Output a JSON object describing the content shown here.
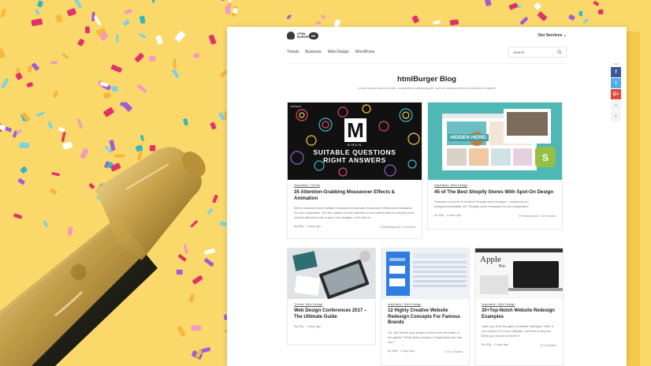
{
  "logo": {
    "text": "HTML BURGER",
    "badge": "BE"
  },
  "header": {
    "services_label": "Our Services",
    "services_icon": "chevron-down-icon"
  },
  "nav": {
    "items": [
      "Trends",
      "Business",
      "Web Design",
      "WordPress"
    ]
  },
  "search": {
    "placeholder": "Search",
    "icon": "search-icon"
  },
  "hero": {
    "title": "htmlBurger Blog",
    "subtitle": "Lorem ipsum dolor sit amet, consectetur adipiscing elit, sed do eiusmod tempor incididunt ut labore"
  },
  "share": {
    "label": "Share",
    "buttons": [
      "f",
      "t",
      "G+"
    ]
  },
  "cards": [
    {
      "image_label_top": "CONTACT",
      "image_brand": "MINNIN",
      "image_headline_1": "SUITABLE QUESTIONS",
      "image_headline_2": "RIGHT ANSWERS",
      "category": "Inspiration, Trends",
      "title": "35 Attention-Grabbing Mouseover Effects & Animation",
      "excerpt": "We've collected some brilliant examples of website mouseover effects and animation for your inspiration. We also added to this collection some useful links for sample (and simple) effects to use in your own designs. Let's dive in.",
      "author": "By Billy",
      "date": "2 days ago",
      "reading": "Reading time: 5 minutes"
    },
    {
      "image_headline": "HIDDEN HERE!",
      "category": "Inspiration, Web Design",
      "title": "45 of The Best Shopify Stores With Spot-On Design",
      "excerpt": "Selection of some of the best Shopify store designs + comments on design/functionality. 40+ Shopify store examples for your inspiration.",
      "author": "By Billy",
      "date": "4 days ago",
      "reading": "Reading time: 10 minutes"
    },
    {
      "category": "Trends, Web Design",
      "title": "Web Design Conferences 2017 – The Ultimate Guide",
      "author": "By Billy",
      "date": "2 days ago"
    },
    {
      "category": "Inspiration, Web Design",
      "title": "12 Highly Creative Website Redesign Concepts For Famous Brands",
      "excerpt": "Ok. But what if your project is less from the scale of the giants? What other sources of inspiration you can use?",
      "author": "By Billy",
      "date": "2 days ago",
      "reading": "11 minutes"
    },
    {
      "image_brand": "Apple",
      "image_product": "Pro",
      "category": "Inspiration, Web Design",
      "title": "30+Top-Notch Website Redesign Examples",
      "excerpt": "Have you ever thought of website redesign? Well, if you haven't it is not a disaster, but here is why we think you should consider it.",
      "author": "By Billy",
      "date": "2 days ago",
      "reading": "9 minutes"
    }
  ],
  "colors": {
    "background": "#fbd86a",
    "facebook": "#3b5998",
    "twitter": "#55acee",
    "google": "#dd4b39",
    "teal": "#4fb8b5"
  }
}
